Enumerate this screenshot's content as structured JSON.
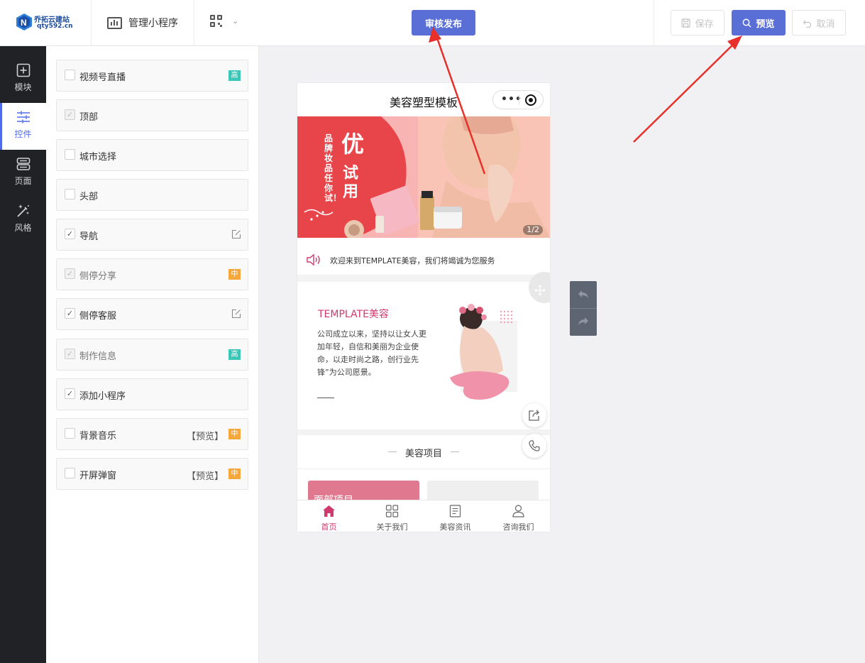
{
  "logo": {
    "line1": "乔拓云建站",
    "line2": "qty592.cn"
  },
  "header": {
    "manage_label": "管理小程序",
    "publish_label": "审核发布",
    "save_label": "保存",
    "preview_label": "预览",
    "cancel_label": "取消"
  },
  "nav": [
    {
      "label": "模块",
      "icon": "plus-square-icon"
    },
    {
      "label": "控件",
      "icon": "sliders-icon"
    },
    {
      "label": "页面",
      "icon": "pages-icon"
    },
    {
      "label": "风格",
      "icon": "magic-wand-icon"
    }
  ],
  "controls": [
    {
      "label": "视频号直播",
      "checked": false,
      "tag": "高",
      "tag_color": "#3cc6b7"
    },
    {
      "label": "顶部",
      "checked": true,
      "disabled": true
    },
    {
      "label": "城市选择",
      "checked": false
    },
    {
      "label": "头部",
      "checked": false
    },
    {
      "label": "导航",
      "checked": true,
      "edit": true
    },
    {
      "label": "侧停分享",
      "checked": true,
      "disabled": true,
      "tag": "中",
      "tag_color": "#f6a83b"
    },
    {
      "label": "侧停客服",
      "checked": true,
      "edit": true
    },
    {
      "label": "制作信息",
      "checked": true,
      "disabled": true,
      "tag": "高",
      "tag_color": "#3cc6b7"
    },
    {
      "label": "添加小程序",
      "checked": true
    },
    {
      "label": "背景音乐",
      "checked": false,
      "preview": "【预览】",
      "tag": "中",
      "tag_color": "#f6a83b"
    },
    {
      "label": "开屏弹窗",
      "checked": false,
      "preview": "【预览】",
      "tag": "中",
      "tag_color": "#f6a83b"
    }
  ],
  "phone": {
    "title": "美容塑型模板",
    "banner": {
      "vertical_text": "品牌妆品任你试！",
      "big1": "优",
      "big2": "试",
      "big3": "用",
      "page_indicator": "1/2"
    },
    "notice": "欢迎来到TEMPLATE美容，我们将竭诚为您服务",
    "about": {
      "heading": "TEMPLATE美容",
      "body": "公司成立以来，坚持以让女人更加年轻，自信和美丽为企业使命，以走时尚之路，创行业先锋”为公司愿景。"
    },
    "section_title": "美容项目",
    "card1_text": "面部项目",
    "tabs": [
      {
        "label": "首页",
        "icon": "home-icon"
      },
      {
        "label": "关于我们",
        "icon": "grid-icon"
      },
      {
        "label": "美容资讯",
        "icon": "article-icon"
      },
      {
        "label": "咨询我们",
        "icon": "user-icon"
      }
    ]
  },
  "colors": {
    "accent": "#5a6fd6",
    "brand_pink": "#d0386e",
    "nav_bg": "#212226",
    "tag_high": "#3cc6b7",
    "tag_mid": "#f6a83b",
    "arrow": "#e8302a"
  }
}
